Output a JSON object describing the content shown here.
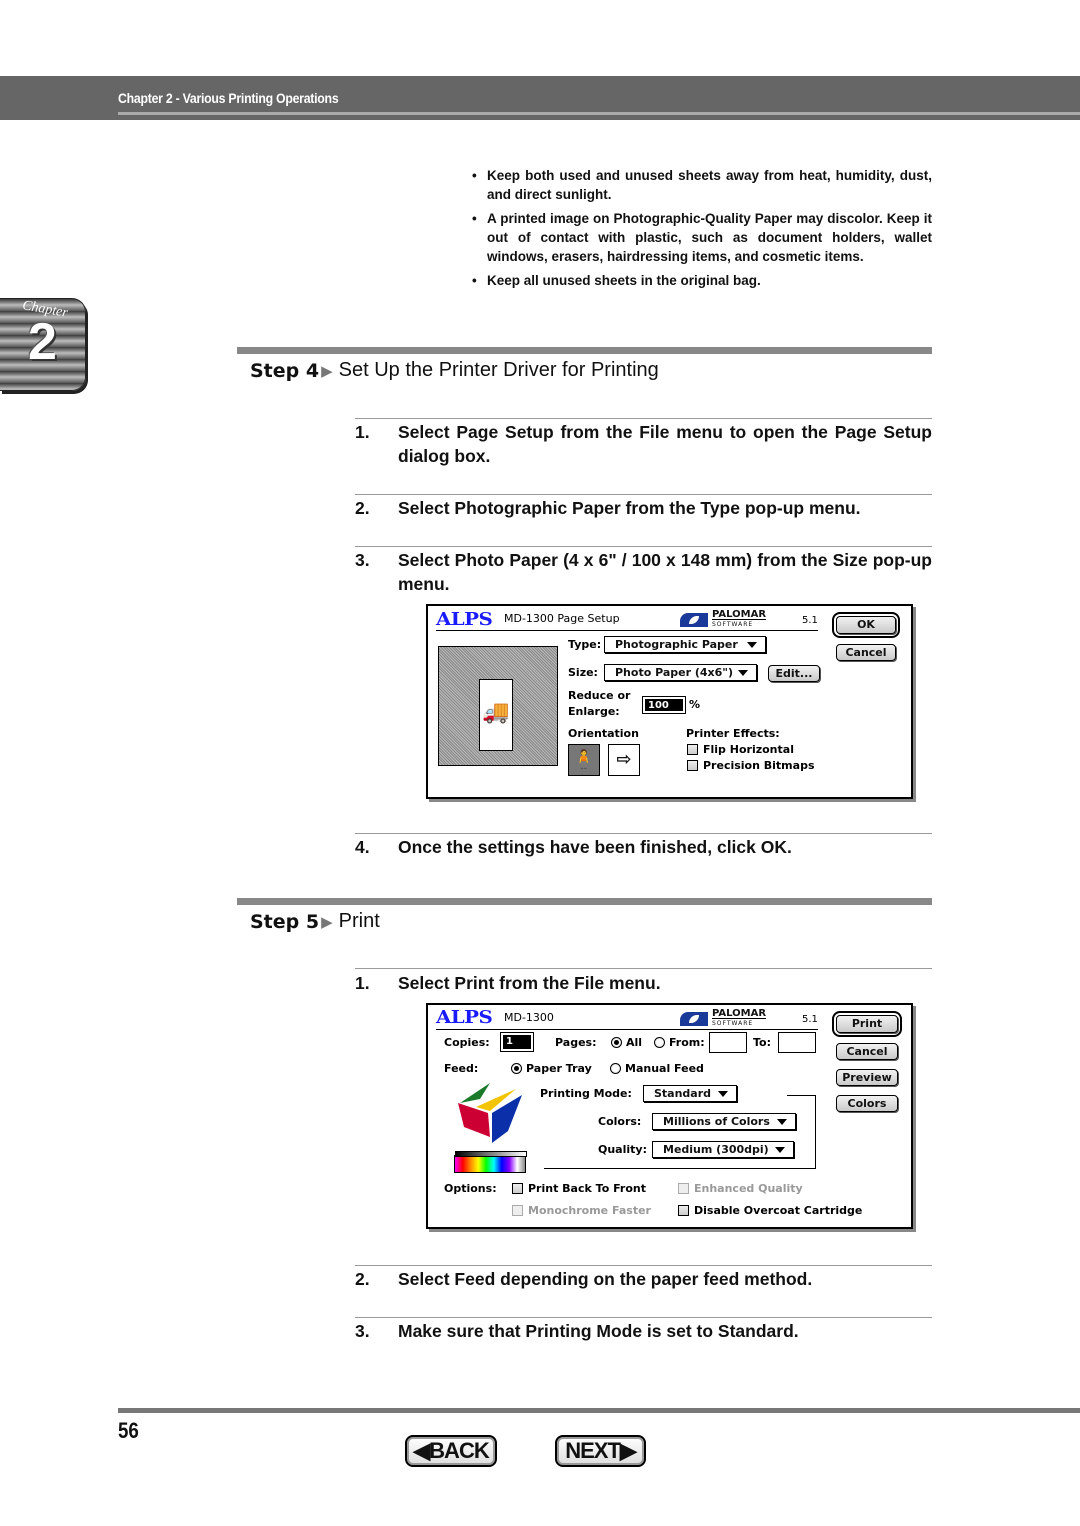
{
  "header": {
    "title": "Chapter 2 - Various Printing Operations"
  },
  "chapter_tab": {
    "word": "Chapter",
    "number": "2"
  },
  "bullets": [
    "Keep both used and unused sheets away from heat, humidity, dust, and direct sunlight.",
    "A printed image on Photographic-Quality Paper may discolor. Keep it out of contact with plastic, such as document holders, wallet windows, erasers, hairdressing items, and cosmetic items.",
    "Keep all unused sheets in the original bag."
  ],
  "step4": {
    "label": "Step 4",
    "title": "Set Up the Printer Driver for Printing",
    "instructions": [
      {
        "num": "1.",
        "text": "Select Page Setup from the File menu to open the Page Setup dialog box."
      },
      {
        "num": "2.",
        "text": "Select Photographic Paper from the Type pop-up menu."
      },
      {
        "num": "3.",
        "text": "Select Photo Paper (4 x 6\" / 100 x 148 mm) from the Size pop-up menu."
      },
      {
        "num": "4.",
        "text": "Once the settings have been finished, click OK."
      }
    ]
  },
  "page_setup_dialog": {
    "brand": "ALPS",
    "title": "MD-1300 Page Setup",
    "vendor": "PALOMAR",
    "vendor_sub": "SOFTWARE",
    "version": "5.1",
    "type_label": "Type:",
    "type_value": "Photographic Paper",
    "size_label": "Size:",
    "size_value": "Photo Paper (4x6\")",
    "edit_button": "Edit...",
    "reduce_label_1": "Reduce or",
    "reduce_label_2": "Enlarge:",
    "reduce_value": "100",
    "percent": "%",
    "orientation_label": "Orientation",
    "effects_label": "Printer Effects:",
    "flip_horizontal": "Flip Horizontal",
    "precision_bitmaps": "Precision Bitmaps",
    "ok_button": "OK",
    "cancel_button": "Cancel"
  },
  "step5": {
    "label": "Step 5",
    "title": "Print",
    "instructions": [
      {
        "num": "1.",
        "text": "Select Print from the File menu."
      },
      {
        "num": "2.",
        "text": "Select Feed depending on the paper feed method."
      },
      {
        "num": "3.",
        "text": "Make sure that Printing Mode is set to Standard."
      }
    ]
  },
  "print_dialog": {
    "brand": "ALPS",
    "title": "MD-1300",
    "vendor": "PALOMAR",
    "vendor_sub": "SOFTWARE",
    "version": "5.1",
    "copies_label": "Copies:",
    "copies_value": "1",
    "pages_label": "Pages:",
    "all_label": "All",
    "from_label": "From:",
    "to_label": "To:",
    "feed_label": "Feed:",
    "paper_tray": "Paper Tray",
    "manual_feed": "Manual Feed",
    "printing_mode_label": "Printing Mode:",
    "printing_mode_value": "Standard",
    "colors_label": "Colors:",
    "colors_value": "Millions of Colors",
    "quality_label": "Quality:",
    "quality_value": "Medium (300dpi)",
    "options_label": "Options:",
    "print_back_to_front": "Print Back To Front",
    "enhanced_quality": "Enhanced Quality",
    "monochrome_faster": "Monochrome Faster",
    "disable_overcoat": "Disable Overcoat Cartridge",
    "print_button": "Print",
    "cancel_button": "Cancel",
    "preview_button": "Preview",
    "colors_button": "Colors"
  },
  "footer": {
    "page_number": "56",
    "back": "◀BACK",
    "next": "NEXT▶"
  }
}
